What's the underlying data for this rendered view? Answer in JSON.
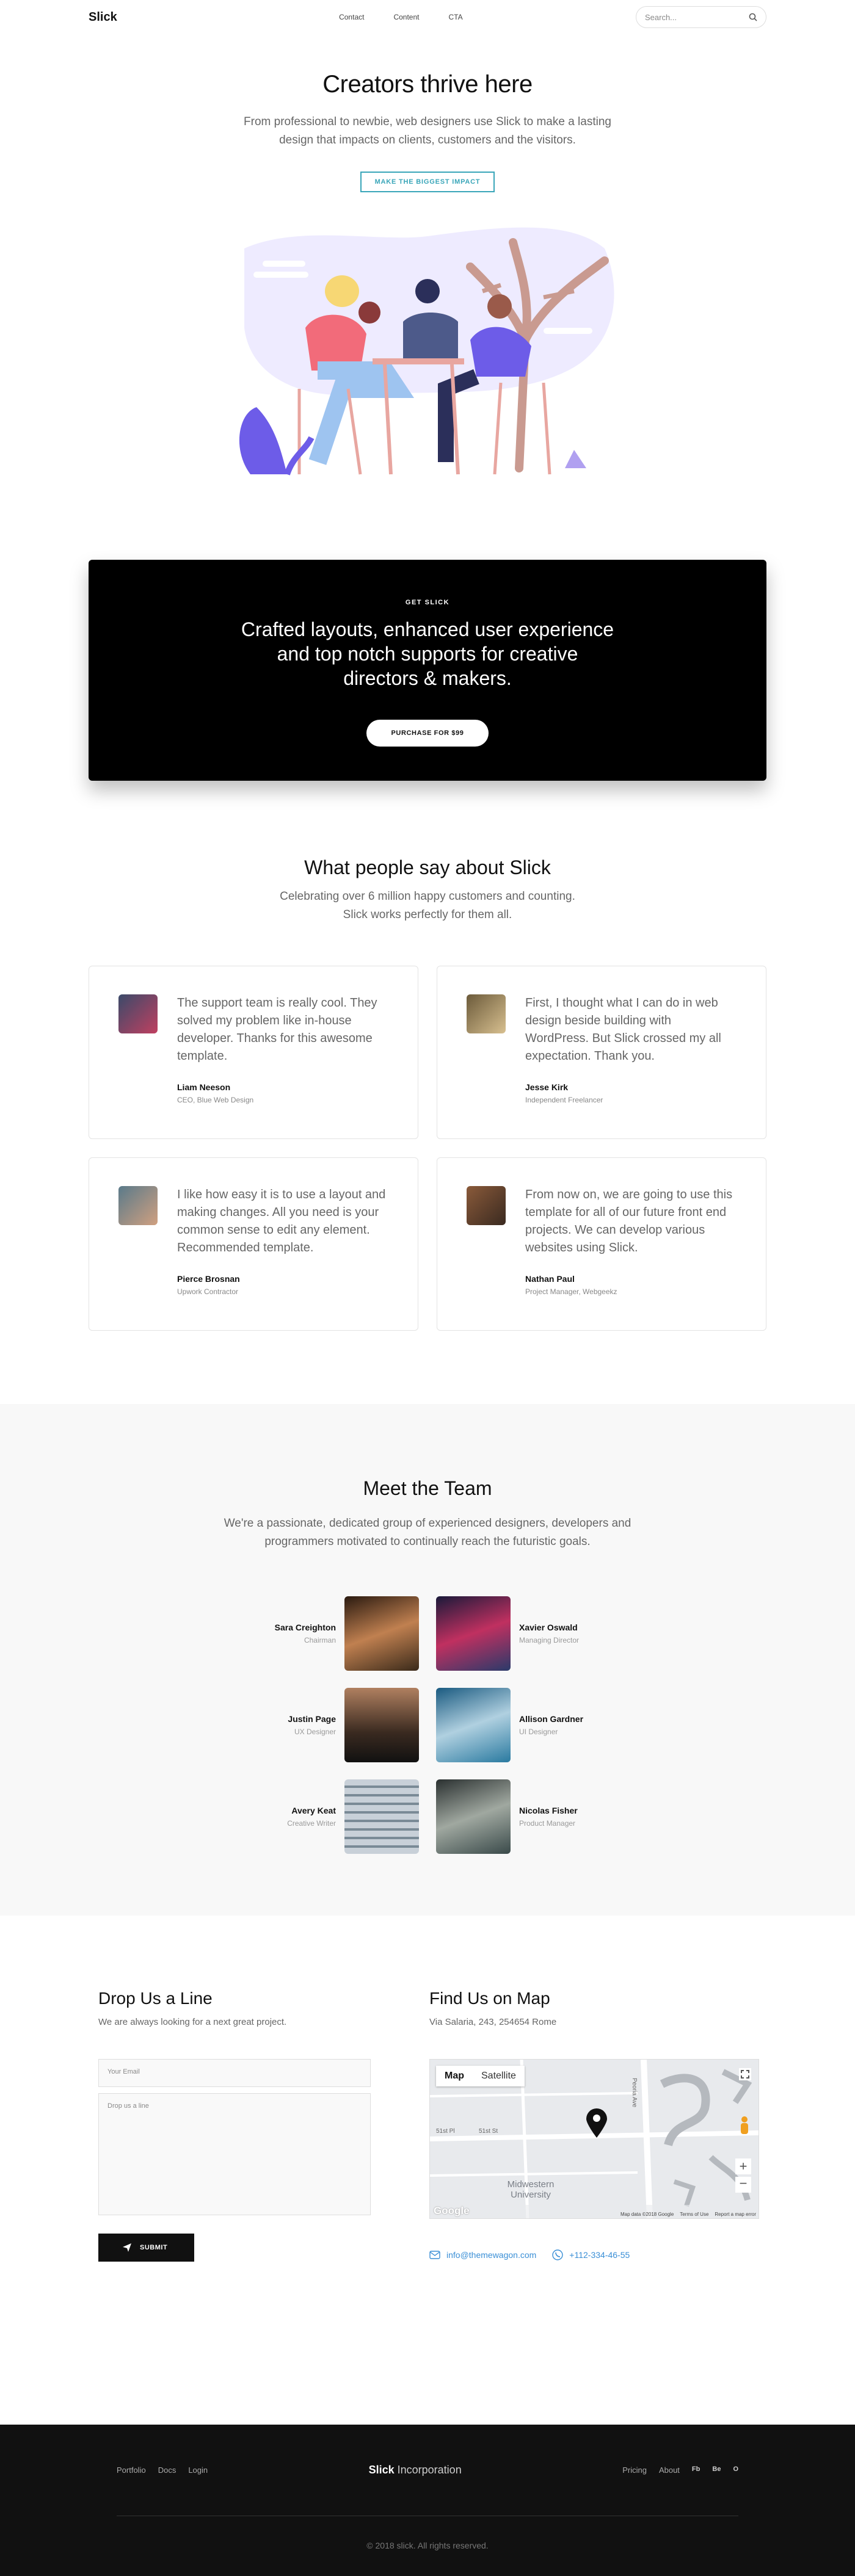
{
  "nav": {
    "brand": "Slick",
    "links": [
      "Contact",
      "Content",
      "CTA"
    ],
    "search_placeholder": "Search..."
  },
  "hero": {
    "title": "Creators thrive here",
    "subtitle": "From professional to newbie, web designers use Slick to make a lasting design that impacts on clients, customers and the visitors.",
    "button": "MAKE THE BIGGEST IMPACT"
  },
  "cta": {
    "kicker": "GET SLICK",
    "title": "Crafted layouts, enhanced user experience and top notch supports for creative directors & makers.",
    "button": "PURCHASE FOR $99"
  },
  "testimonials": {
    "title": "What people say about Slick",
    "subtitle": "Celebrating over 6 million happy customers and counting. Slick works perfectly for them all.",
    "items": [
      {
        "quote": "The support team is really cool. They solved my problem like in-house developer. Thanks for this awesome template.",
        "name": "Liam Neeson",
        "role": "CEO, Blue Web Design",
        "color": "#3a4a6a"
      },
      {
        "quote": "First, I thought what I can do in web design beside building with WordPress. But Slick crossed my all expectation. Thank you.",
        "name": "Jesse Kirk",
        "role": "Independent Freelancer",
        "color": "#6b5a3a"
      },
      {
        "quote": "I like how easy it is to use a layout and making changes. All you need is your common sense to edit any element. Recommended template.",
        "name": "Pierce Brosnan",
        "role": "Upwork Contractor",
        "color": "#5a7a8a"
      },
      {
        "quote": "From now on, we are going to use this template for all of our future front end projects. We can develop various websites using Slick.",
        "name": "Nathan Paul",
        "role": "Project Manager, Webgeekz",
        "color": "#8a5a3a"
      }
    ]
  },
  "team": {
    "title": "Meet the Team",
    "subtitle": "We're a passionate, dedicated group of experienced designers, developers and programmers motivated to continually reach the futuristic goals.",
    "members": [
      {
        "name": "Sara Creighton",
        "role": "Chairman",
        "color": "#7a5a3a"
      },
      {
        "name": "Xavier Oswald",
        "role": "Managing Director",
        "color": "#2a2a4a"
      },
      {
        "name": "Justin Page",
        "role": "UX Designer",
        "color": "#8a6a4a"
      },
      {
        "name": "Allison Gardner",
        "role": "UI Designer",
        "color": "#2a7aa0"
      },
      {
        "name": "Avery Keat",
        "role": "Creative Writer",
        "color": "#9aa8b0"
      },
      {
        "name": "Nicolas Fisher",
        "role": "Product Manager",
        "color": "#4a5a5a"
      }
    ]
  },
  "contact": {
    "title": "Drop Us a Line",
    "subtitle": "We are always looking for a next great project.",
    "email_placeholder": "Your Email",
    "message_placeholder": "Drop us a line",
    "submit": "SUBMIT"
  },
  "map": {
    "title": "Find Us on Map",
    "address": "Via Salaria, 243, 254654 Rome",
    "tab_map": "Map",
    "tab_satellite": "Satellite",
    "label_university": "Midwestern University",
    "label_street1": "51st St",
    "label_street2": "51st Pl",
    "label_street3": "Peoria Ave",
    "attribution": "Map data ©2018 Google",
    "terms": "Terms of Use",
    "report": "Report a map error",
    "google": "Google",
    "email": "info@themewagon.com",
    "phone": "+112-334-46-55"
  },
  "footer": {
    "left_links": [
      "Portfolio",
      "Docs",
      "Login"
    ],
    "brand_bold": "Slick",
    "brand_rest": " Incorporation",
    "right_links": [
      "Pricing",
      "About"
    ],
    "social": [
      "Fb",
      "Be",
      "O"
    ],
    "copyright": "© 2018 slick. All rights reserved."
  },
  "colors": {
    "accent": "#3aa6b9",
    "link": "#3a8fd6",
    "illustration": "#6d5ce8"
  }
}
